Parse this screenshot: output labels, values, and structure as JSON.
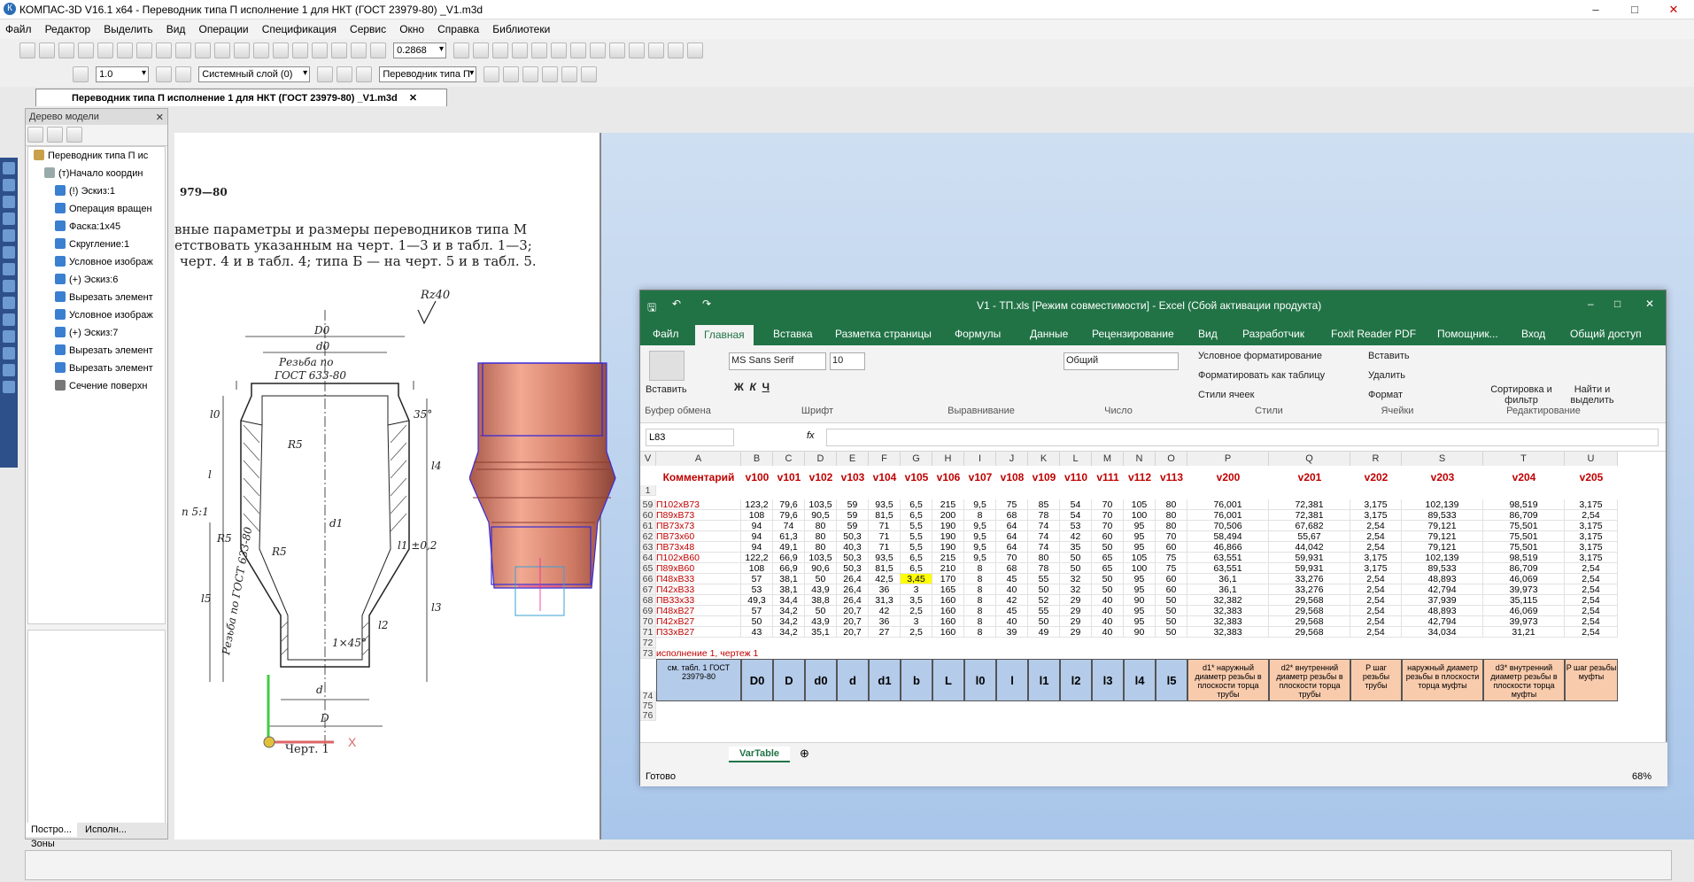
{
  "app_title": "КОМПАС-3D V16.1 x64 - Переводник типа П исполнение 1 для НКТ (ГОСТ 23979-80) _V1.m3d",
  "menu": [
    "Файл",
    "Редактор",
    "Выделить",
    "Вид",
    "Операции",
    "Спецификация",
    "Сервис",
    "Окно",
    "Справка",
    "Библиотеки"
  ],
  "toolbar": {
    "scale": "0.2868",
    "step": "1.0",
    "layer": "Системный слой (0)",
    "part": "Переводник типа П"
  },
  "doc_tab": "Переводник типа П исполнение 1 для НКТ (ГОСТ 23979-80) _V1.m3d",
  "tree": {
    "header": "Дерево модели",
    "items": [
      "Переводник типа П ис",
      "(т)Начало координ",
      "(!) Эскиз:1",
      "Операция вращен",
      "Фаска:1х45",
      "Скругление:1",
      "Условное изображ",
      "(+) Эскиз:6",
      "Вырезать элемент",
      "Условное изображ",
      "(+) Эскиз:7",
      "Вырезать элемент",
      "Вырезать элемент",
      "Сечение поверхн"
    ],
    "tabs": [
      "Постро...",
      "Исполн...",
      "Зоны"
    ]
  },
  "drawing": {
    "std": "979—80",
    "text1": "вные параметры и размеры переводников типа  М",
    "text2": "етствовать указанным на черт. 1—3 и в табл. 1—3;",
    "text3": "черт. 4 и в табл. 4; типа Б — на черт. 5 и в табл. 5.",
    "rz": "Rz40",
    "caption": "Черт. 1",
    "labels": [
      "D0",
      "d0",
      "Резьба по",
      "ГОСТ 633-80",
      "R5",
      "R5",
      "R5",
      "d1",
      "d",
      "D",
      "35°",
      "l1 ±0,2",
      "l4",
      "l3",
      "l2",
      "l5",
      "l",
      "l0",
      "n 5:1",
      "1×45°",
      "Резьба по ГОСТ 633-80"
    ],
    "axis_x": "X"
  },
  "excel": {
    "title": "V1 - ТП.xls  [Режим совместимости] - Excel (Сбой активации продукта)",
    "tabs": [
      "Файл",
      "Главная",
      "Вставка",
      "Разметка страницы",
      "Формулы",
      "Данные",
      "Рецензирование",
      "Вид",
      "Разработчик",
      "Foxit Reader PDF",
      "Помощник...",
      "Вход",
      "Общий доступ"
    ],
    "ribbon": {
      "paste": "Вставить",
      "clipboard": "Буфер обмена",
      "font": "MS Sans Serif",
      "size": "10",
      "font_group": "Шрифт",
      "align_group": "Выравнивание",
      "number_format": "Общий",
      "number_group": "Число",
      "cond": "Условное форматирование",
      "astable": "Форматировать как таблицу",
      "styles": "Стили ячеек",
      "styles_group": "Стили",
      "insert": "Вставить",
      "delete": "Удалить",
      "format": "Формат",
      "cells_group": "Ячейки",
      "sort": "Сортировка и фильтр",
      "find": "Найти и выделить",
      "edit_group": "Редактирование"
    },
    "namebox": "L83",
    "fx": "fx",
    "columns": [
      "A",
      "B",
      "C",
      "D",
      "E",
      "F",
      "G",
      "H",
      "I",
      "J",
      "K",
      "L",
      "M",
      "N",
      "O",
      "P",
      "Q",
      "R",
      "S",
      "T",
      "U",
      "V"
    ],
    "header_row": [
      "Комментарий",
      "v100",
      "v101",
      "v102",
      "v103",
      "v104",
      "v105",
      "v106",
      "v107",
      "v108",
      "v109",
      "v110",
      "v111",
      "v112",
      "v113",
      "v200",
      "v201",
      "v202",
      "v203",
      "v204",
      "v205"
    ],
    "rows": [
      [
        "59",
        "П102хВ73",
        "123,2",
        "79,6",
        "103,5",
        "59",
        "93,5",
        "6,5",
        "215",
        "9,5",
        "75",
        "85",
        "54",
        "70",
        "105",
        "80",
        "76,001",
        "72,381",
        "3,175",
        "102,139",
        "98,519",
        "3,175"
      ],
      [
        "60",
        "П89хВ73",
        "108",
        "79,6",
        "90,5",
        "59",
        "81,5",
        "6,5",
        "200",
        "8",
        "68",
        "78",
        "54",
        "70",
        "100",
        "80",
        "76,001",
        "72,381",
        "3,175",
        "89,533",
        "86,709",
        "2,54"
      ],
      [
        "61",
        "ПВ73х73",
        "94",
        "74",
        "80",
        "59",
        "71",
        "5,5",
        "190",
        "9,5",
        "64",
        "74",
        "53",
        "70",
        "95",
        "80",
        "70,506",
        "67,682",
        "2,54",
        "79,121",
        "75,501",
        "3,175"
      ],
      [
        "62",
        "ПВ73х60",
        "94",
        "61,3",
        "80",
        "50,3",
        "71",
        "5,5",
        "190",
        "9,5",
        "64",
        "74",
        "42",
        "60",
        "95",
        "70",
        "58,494",
        "55,67",
        "2,54",
        "79,121",
        "75,501",
        "3,175"
      ],
      [
        "63",
        "ПВ73х48",
        "94",
        "49,1",
        "80",
        "40,3",
        "71",
        "5,5",
        "190",
        "9,5",
        "64",
        "74",
        "35",
        "50",
        "95",
        "60",
        "46,866",
        "44,042",
        "2,54",
        "79,121",
        "75,501",
        "3,175"
      ],
      [
        "64",
        "П102хВ60",
        "122,2",
        "66,9",
        "103,5",
        "50,3",
        "93,5",
        "6,5",
        "215",
        "9,5",
        "70",
        "80",
        "50",
        "65",
        "105",
        "75",
        "63,551",
        "59,931",
        "3,175",
        "102,139",
        "98,519",
        "3,175"
      ],
      [
        "65",
        "П89хВ60",
        "108",
        "66,9",
        "90,6",
        "50,3",
        "81,5",
        "6,5",
        "210",
        "8",
        "68",
        "78",
        "50",
        "65",
        "100",
        "75",
        "63,551",
        "59,931",
        "3,175",
        "89,533",
        "86,709",
        "2,54"
      ],
      [
        "66",
        "П48хВ33",
        "57",
        "38,1",
        "50",
        "26,4",
        "42,5",
        "3,45",
        "170",
        "8",
        "45",
        "55",
        "32",
        "50",
        "95",
        "60",
        "36,1",
        "33,276",
        "2,54",
        "48,893",
        "46,069",
        "2,54"
      ],
      [
        "67",
        "П42хВ33",
        "53",
        "38,1",
        "43,9",
        "26,4",
        "36",
        "3",
        "165",
        "8",
        "40",
        "50",
        "32",
        "50",
        "95",
        "60",
        "36,1",
        "33,276",
        "2,54",
        "42,794",
        "39,973",
        "2,54"
      ],
      [
        "68",
        "ПВ33х33",
        "49,3",
        "34,4",
        "38,8",
        "26,4",
        "31,3",
        "3,5",
        "160",
        "8",
        "42",
        "52",
        "29",
        "40",
        "90",
        "50",
        "32,382",
        "29,568",
        "2,54",
        "37,939",
        "35,115",
        "2,54"
      ],
      [
        "69",
        "П48хВ27",
        "57",
        "34,2",
        "50",
        "20,7",
        "42",
        "2,5",
        "160",
        "8",
        "45",
        "55",
        "29",
        "40",
        "95",
        "50",
        "32,383",
        "29,568",
        "2,54",
        "48,893",
        "46,069",
        "2,54"
      ],
      [
        "70",
        "П42хВ27",
        "50",
        "34,2",
        "43,9",
        "20,7",
        "36",
        "3",
        "160",
        "8",
        "40",
        "50",
        "29",
        "40",
        "95",
        "50",
        "32,383",
        "29,568",
        "2,54",
        "42,794",
        "39,973",
        "2,54"
      ],
      [
        "71",
        "П33хВ27",
        "43",
        "34,2",
        "35,1",
        "20,7",
        "27",
        "2,5",
        "160",
        "8",
        "39",
        "49",
        "29",
        "40",
        "90",
        "50",
        "32,383",
        "29,568",
        "2,54",
        "34,034",
        "31,21",
        "2,54"
      ]
    ],
    "row72": "72",
    "row73": "73",
    "row73_text": "исполнение 1, чертеж 1",
    "legend": [
      "см. табл. 1 ГОСТ 23979-80",
      "D0",
      "D",
      "d0",
      "d",
      "d1",
      "b",
      "L",
      "l0",
      "l",
      "l1",
      "l2",
      "l3",
      "l4",
      "l5",
      "d1* наружный диаметр резьбы в плоскости торца трубы",
      "d2* внутренний диаметр резьбы в плоскости торца трубы",
      "P шаг резьбы трубы",
      "наружный диаметр резьбы в плоскости торца муфты",
      "d3* внутренний диаметр резьбы в плоскости торца муфты",
      "P шаг резьбы муфты"
    ],
    "row74": "74",
    "row75": "75",
    "row76": "76",
    "sheet_tab": "VarTable",
    "status": "Готово",
    "zoom": "68%"
  },
  "colors": {
    "excel_green": "#217346",
    "legend_blue": "#b4cbe9",
    "legend_orange": "#f8cbad",
    "highlight": "#ffff00"
  }
}
